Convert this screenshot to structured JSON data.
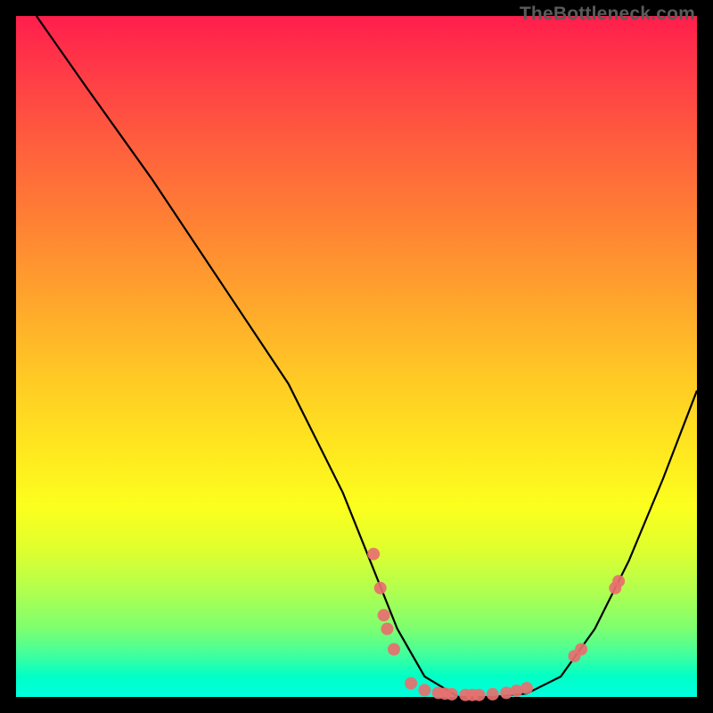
{
  "watermark": "TheBottleneck.com",
  "chart_data": {
    "type": "line",
    "title": "",
    "xlabel": "",
    "ylabel": "",
    "xlim": [
      0,
      100
    ],
    "ylim": [
      0,
      100
    ],
    "series": [
      {
        "name": "curve",
        "x": [
          3,
          10,
          20,
          30,
          40,
          48,
          52,
          56,
          60,
          65,
          70,
          75,
          80,
          85,
          90,
          95,
          100
        ],
        "y": [
          100,
          90,
          76,
          61,
          46,
          30,
          20,
          10,
          3,
          0,
          0,
          0.5,
          3,
          10,
          20,
          32,
          45
        ]
      }
    ],
    "markers": [
      {
        "x": 52.5,
        "y": 21
      },
      {
        "x": 53.5,
        "y": 16
      },
      {
        "x": 54,
        "y": 12
      },
      {
        "x": 54.5,
        "y": 10
      },
      {
        "x": 55.5,
        "y": 7
      },
      {
        "x": 58,
        "y": 2
      },
      {
        "x": 60,
        "y": 1
      },
      {
        "x": 62,
        "y": 0.6
      },
      {
        "x": 63,
        "y": 0.5
      },
      {
        "x": 64,
        "y": 0.4
      },
      {
        "x": 66,
        "y": 0.3
      },
      {
        "x": 67,
        "y": 0.3
      },
      {
        "x": 68,
        "y": 0.3
      },
      {
        "x": 70,
        "y": 0.4
      },
      {
        "x": 72,
        "y": 0.6
      },
      {
        "x": 73.5,
        "y": 0.9
      },
      {
        "x": 75,
        "y": 1.3
      },
      {
        "x": 82,
        "y": 6
      },
      {
        "x": 83,
        "y": 7
      },
      {
        "x": 88,
        "y": 16
      },
      {
        "x": 88.5,
        "y": 17
      }
    ]
  }
}
